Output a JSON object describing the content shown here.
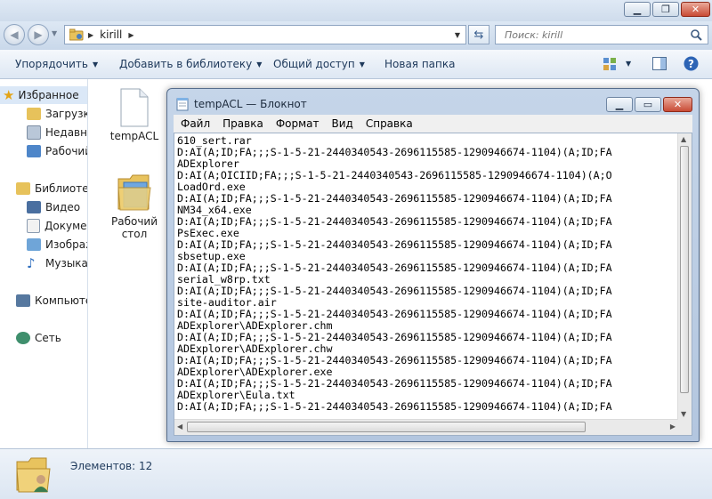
{
  "address": {
    "crumb": "kirill"
  },
  "search": {
    "placeholder": "Поиск: kirill"
  },
  "toolbar": {
    "organize": "Упорядочить",
    "add_library": "Добавить в библиотеку",
    "share": "Общий доступ",
    "new_folder": "Новая папка"
  },
  "nav": {
    "favorites": "Избранное",
    "downloads": "Загрузки",
    "recent": "Недавние места",
    "desktop": "Рабочий стол",
    "libraries": "Библиотеки",
    "video": "Видео",
    "documents": "Документы",
    "images": "Изображения",
    "music": "Музыка",
    "computer": "Компьютер",
    "network": "Сеть"
  },
  "files": [
    {
      "name": "tempACL"
    },
    {
      "name": "Рабочий стол"
    }
  ],
  "status": {
    "count": "Элементов: 12"
  },
  "notepad": {
    "title": "tempACL — Блокнот",
    "menu": [
      "Файл",
      "Правка",
      "Формат",
      "Вид",
      "Справка"
    ],
    "lines": [
      "610_sert.rar",
      "D:AI(A;ID;FA;;;S-1-5-21-2440340543-2696115585-1290946674-1104)(A;ID;FA",
      "ADExplorer",
      "D:AI(A;OICIID;FA;;;S-1-5-21-2440340543-2696115585-1290946674-1104)(A;O",
      "LoadOrd.exe",
      "D:AI(A;ID;FA;;;S-1-5-21-2440340543-2696115585-1290946674-1104)(A;ID;FA",
      "NM34_x64.exe",
      "D:AI(A;ID;FA;;;S-1-5-21-2440340543-2696115585-1290946674-1104)(A;ID;FA",
      "PsExec.exe",
      "D:AI(A;ID;FA;;;S-1-5-21-2440340543-2696115585-1290946674-1104)(A;ID;FA",
      "sbsetup.exe",
      "D:AI(A;ID;FA;;;S-1-5-21-2440340543-2696115585-1290946674-1104)(A;ID;FA",
      "serial_w8rp.txt",
      "D:AI(A;ID;FA;;;S-1-5-21-2440340543-2696115585-1290946674-1104)(A;ID;FA",
      "site-auditor.air",
      "D:AI(A;ID;FA;;;S-1-5-21-2440340543-2696115585-1290946674-1104)(A;ID;FA",
      "ADExplorer\\ADExplorer.chm",
      "D:AI(A;ID;FA;;;S-1-5-21-2440340543-2696115585-1290946674-1104)(A;ID;FA",
      "ADExplorer\\ADExplorer.chw",
      "D:AI(A;ID;FA;;;S-1-5-21-2440340543-2696115585-1290946674-1104)(A;ID;FA",
      "ADExplorer\\ADExplorer.exe",
      "D:AI(A;ID;FA;;;S-1-5-21-2440340543-2696115585-1290946674-1104)(A;ID;FA",
      "ADExplorer\\Eula.txt",
      "D:AI(A;ID;FA;;;S-1-5-21-2440340543-2696115585-1290946674-1104)(A;ID;FA"
    ]
  }
}
